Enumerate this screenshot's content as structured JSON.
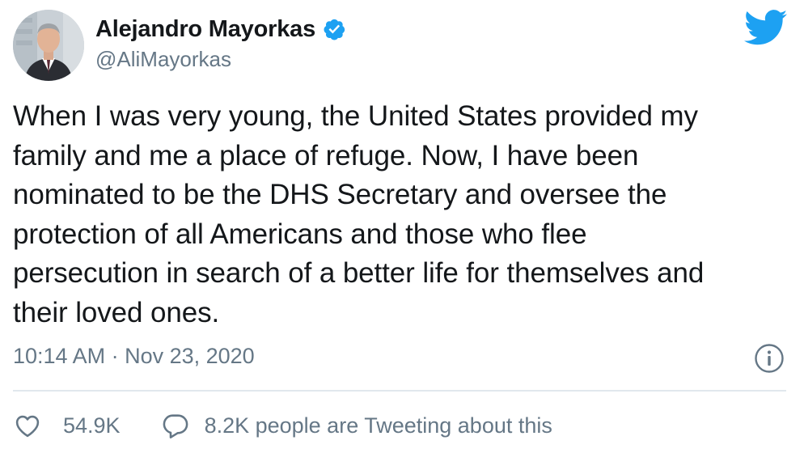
{
  "tweet": {
    "author": {
      "display_name": "Alejandro Mayorkas",
      "handle": "@AliMayorkas",
      "verified": true,
      "avatar_icon": "profile-photo"
    },
    "text": "When I was very young, the United States provided my\nfamily and me a place of refuge. Now, I have been\nnominated to be the DHS Secretary and oversee the\nprotection of all Americans and those who flee\npersecution in search of a better life for themselves and\ntheir loved ones.",
    "timestamp": "10:14 AM · Nov 23, 2020",
    "likes": "54.9K",
    "conversation": "8.2K people are Tweeting about this"
  },
  "icons": {
    "brand": "twitter-bird-icon",
    "verified": "verified-badge-icon",
    "info": "info-icon",
    "like": "heart-icon",
    "reply": "speech-bubble-icon"
  },
  "colors": {
    "brand_blue": "#1da1f2",
    "text_primary": "#14171a",
    "text_secondary": "#657786",
    "divider": "#e1e8ed"
  }
}
